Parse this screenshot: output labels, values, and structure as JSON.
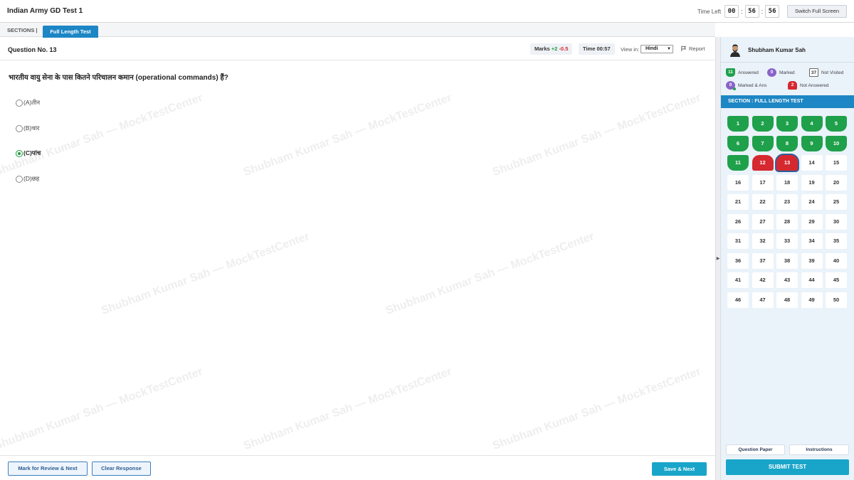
{
  "header": {
    "title": "Indian Army GD Test 1",
    "time_left_label": "Time Left",
    "hours": "00",
    "minutes": "56",
    "seconds": "56",
    "fullscreen_label": "Switch Full Screen"
  },
  "sections": {
    "label": "SECTIONS |",
    "active_tab": "Full Length Test"
  },
  "question_header": {
    "number_label": "Question No. 13",
    "marks_label": "Marks",
    "marks_positive": "+2",
    "marks_negative": "-0.5",
    "time_label": "Time 00:57",
    "view_in_label": "View in:",
    "language": "Hindi",
    "report_label": "Report"
  },
  "question": {
    "text": "भारतीय वायु सेना के पास कितने परिचालन कमान (operational commands) हैं?",
    "options": [
      {
        "label": "(A)तीन",
        "selected": false
      },
      {
        "label": "(B)चार",
        "selected": false
      },
      {
        "label": "(C)पांच",
        "selected": true
      },
      {
        "label": "(D)छह",
        "selected": false
      }
    ]
  },
  "watermark": {
    "text": "Shubham Kumar Sah — MockTestCenter"
  },
  "footer": {
    "mark_review_label": "Mark for Review & Next",
    "clear_label": "Clear Response",
    "save_next_label": "Save & Next"
  },
  "panel": {
    "user_name": "Shubham Kumar Sah",
    "legend": {
      "answered": {
        "count": "11",
        "label": "Answered"
      },
      "marked": {
        "count": "0",
        "label": "Marked"
      },
      "not_visited": {
        "count": "37",
        "label": "Not Visited"
      },
      "marked_ans": {
        "count": "0",
        "label": "Marked & Ans"
      },
      "not_answered": {
        "count": "2",
        "label": "Not Answered"
      }
    },
    "section_title": "SECTION : FULL LENGTH TEST",
    "questions": {
      "total": 50,
      "answered": [
        1,
        2,
        3,
        4,
        5,
        6,
        7,
        8,
        9,
        10,
        11
      ],
      "not_answered": [
        12,
        13
      ],
      "current": 13
    },
    "question_paper_label": "Question Paper",
    "instructions_label": "Instructions",
    "submit_label": "SUBMIT TEST"
  },
  "colors": {
    "accent": "#1d86c4",
    "answered": "#1fa04a",
    "not_answered": "#d6282f",
    "marked": "#8a63c9",
    "submit": "#19a5c9"
  }
}
